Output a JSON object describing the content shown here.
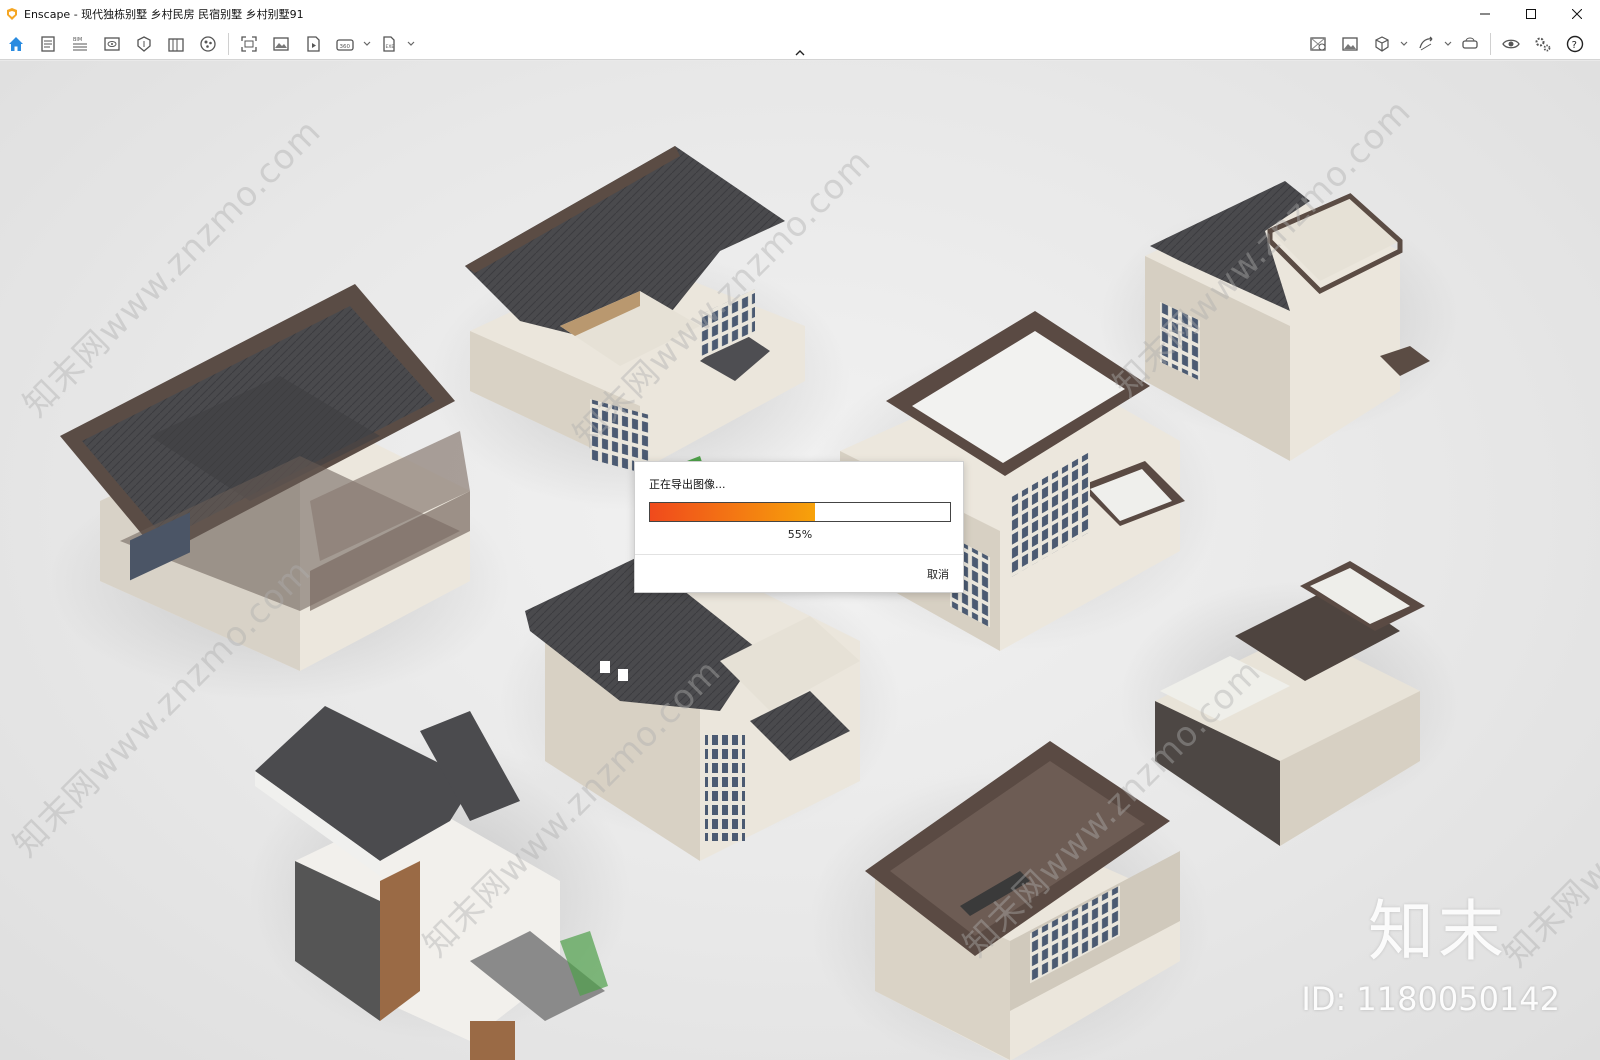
{
  "window": {
    "app_name": "Enscape",
    "title": "Enscape - 现代独栋别墅 乡村民房 民宿别墅 乡村别墅91"
  },
  "toolbar": {
    "left_icons": [
      "home-icon",
      "notes-icon",
      "bim-icon",
      "views-icon",
      "asset-library-icon",
      "material-editor-icon",
      "atmosphere-icon",
      "screenshot-icon",
      "batch-render-icon",
      "video-editor-icon",
      "panorama-360-icon",
      "export-exe-icon"
    ],
    "right_icons": [
      "view-management-icon",
      "image-settings-icon",
      "cube-icon",
      "sync-icon",
      "vr-headset-icon",
      "visual-settings-icon",
      "general-settings-icon",
      "help-icon"
    ]
  },
  "dialog": {
    "message": "正在导出图像...",
    "progress_value": 0.55,
    "progress_text": "55%",
    "cancel_label": "取消",
    "bar_start_color": "#f04a1c",
    "bar_end_color": "#f7a20a"
  },
  "watermark": {
    "text": "知末网www.znzmo.com",
    "brand": "知末",
    "id_text": "ID: 1180050142"
  },
  "colors": {
    "accent": "#1e88e5",
    "logo": "#f5a623"
  }
}
